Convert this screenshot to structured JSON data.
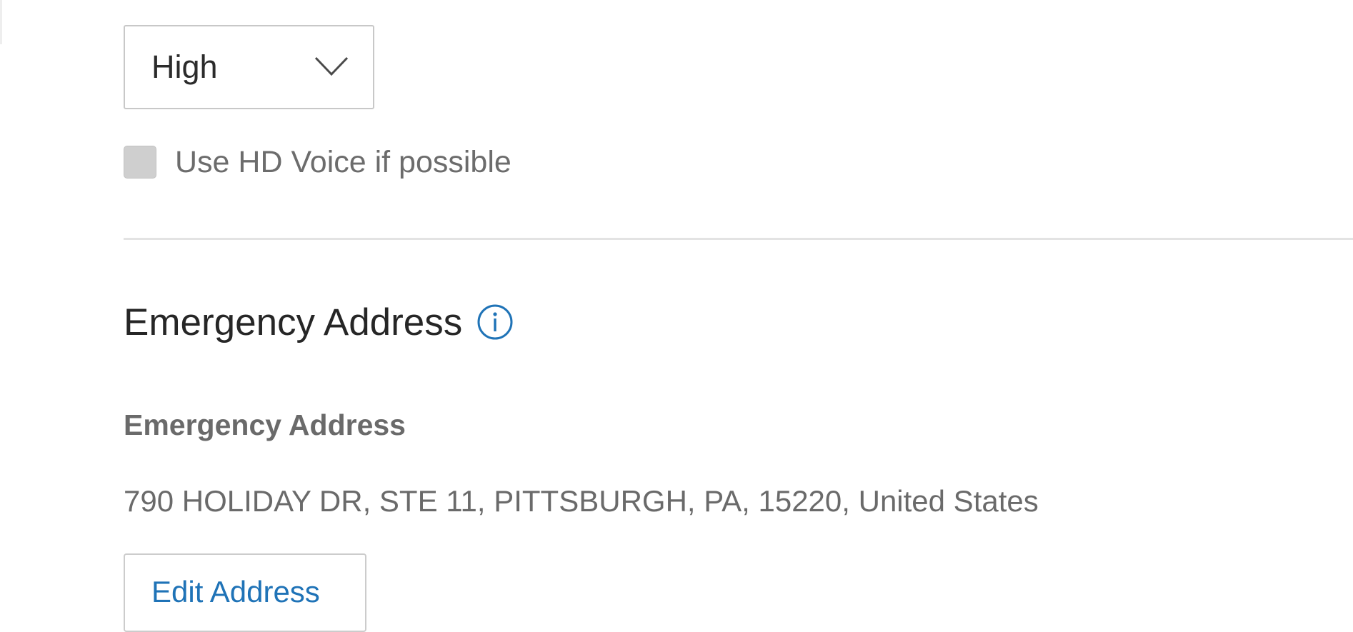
{
  "audio": {
    "quality_select": {
      "value": "High",
      "icon": "chevron-down-icon"
    },
    "hd_voice": {
      "label": "Use HD Voice if possible",
      "checked": false
    }
  },
  "emergency": {
    "section_title": "Emergency Address",
    "info_icon": "info-circle-icon",
    "field_label": "Emergency Address",
    "address": "790 HOLIDAY DR, STE 11, PITTSBURGH, PA, 15220, United States",
    "edit_button_label": "Edit Address"
  },
  "colors": {
    "link_blue": "#1f73b7",
    "text_dark": "#262626",
    "text_muted": "#6a6a6a",
    "border": "#c8c8c8",
    "divider": "#e3e3e3"
  }
}
